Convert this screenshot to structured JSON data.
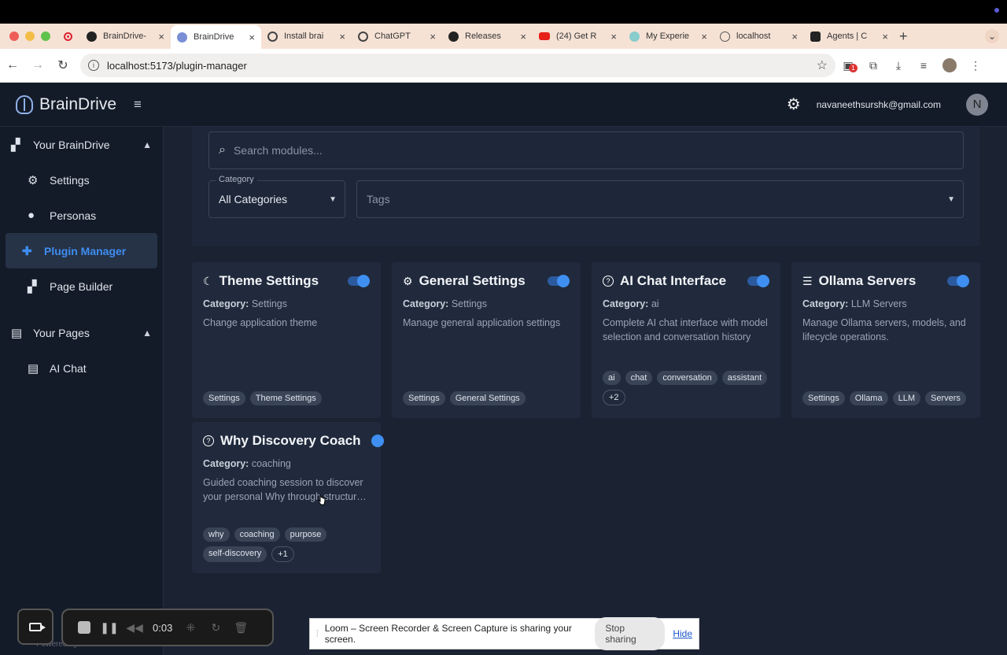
{
  "browser": {
    "tabs": [
      {
        "title": "BrainDrive-",
        "icon": "github-icon",
        "active": false
      },
      {
        "title": "BrainDrive",
        "icon": "braindrive-icon",
        "active": true
      },
      {
        "title": "Install brai",
        "icon": "gpt-icon",
        "active": false
      },
      {
        "title": "ChatGPT",
        "icon": "gpt-icon",
        "active": false
      },
      {
        "title": "Releases",
        "icon": "github-icon",
        "active": false
      },
      {
        "title": "(24) Get R",
        "icon": "youtube-icon",
        "active": false
      },
      {
        "title": "My Experie",
        "icon": "medium-icon",
        "active": false
      },
      {
        "title": "localhost",
        "icon": "globe-icon",
        "active": false
      },
      {
        "title": "Agents | C",
        "icon": "agents-icon",
        "active": false
      }
    ],
    "url": "localhost:5173/plugin-manager"
  },
  "header": {
    "brand": "BrainDrive",
    "email": "navaneethsurshk@gmail.com",
    "avatar_initial": "N"
  },
  "sidebar": {
    "section1": "Your BrainDrive",
    "items1": [
      {
        "label": "Settings",
        "icon": "gear-icon"
      },
      {
        "label": "Personas",
        "icon": "person-icon"
      },
      {
        "label": "Plugin Manager",
        "icon": "puzzle-icon",
        "active": true
      },
      {
        "label": "Page Builder",
        "icon": "builder-icon"
      }
    ],
    "section2": "Your Pages",
    "items2": [
      {
        "label": "AI Chat",
        "icon": "document-icon"
      }
    ],
    "powered": "Powered by BrainDrive"
  },
  "filters": {
    "search_placeholder": "Search modules...",
    "category_label": "Category",
    "category_value": "All Categories",
    "tags_placeholder": "Tags"
  },
  "cards": [
    {
      "name": "Theme Settings",
      "icon": "moon-icon",
      "category_label": "Category:",
      "category": "Settings",
      "description": "Change application theme",
      "tags": [
        "Settings",
        "Theme Settings"
      ],
      "more": "",
      "enabled": true
    },
    {
      "name": "General Settings",
      "icon": "gear-icon",
      "category_label": "Category:",
      "category": "Settings",
      "description": "Manage general application settings",
      "tags": [
        "Settings",
        "General Settings"
      ],
      "more": "",
      "enabled": true
    },
    {
      "name": "AI Chat Interface",
      "icon": "question-icon",
      "category_label": "Category:",
      "category": "ai",
      "description": "Complete AI chat interface with model selection and conversation history",
      "tags": [
        "ai",
        "chat",
        "conversation",
        "assistant"
      ],
      "more": "+2",
      "enabled": true
    },
    {
      "name": "Ollama Servers",
      "icon": "list-icon",
      "category_label": "Category:",
      "category": "LLM Servers",
      "description": "Manage Ollama servers, models, and lifecycle operations.",
      "tags": [
        "Settings",
        "Ollama",
        "LLM",
        "Servers"
      ],
      "more": "",
      "enabled": true
    },
    {
      "name": "Why Discovery Coach",
      "icon": "question-icon",
      "category_label": "Category:",
      "category": "coaching",
      "description": "Guided coaching session to discover your personal Why through structur…",
      "tags": [
        "why",
        "coaching",
        "purpose",
        "self-discovery"
      ],
      "more": "+1",
      "enabled": true
    }
  ],
  "loom": {
    "timer": "0:03",
    "share_text": "Loom – Screen Recorder & Screen Capture is sharing your screen.",
    "stop_label": "Stop sharing",
    "hide_label": "Hide"
  }
}
